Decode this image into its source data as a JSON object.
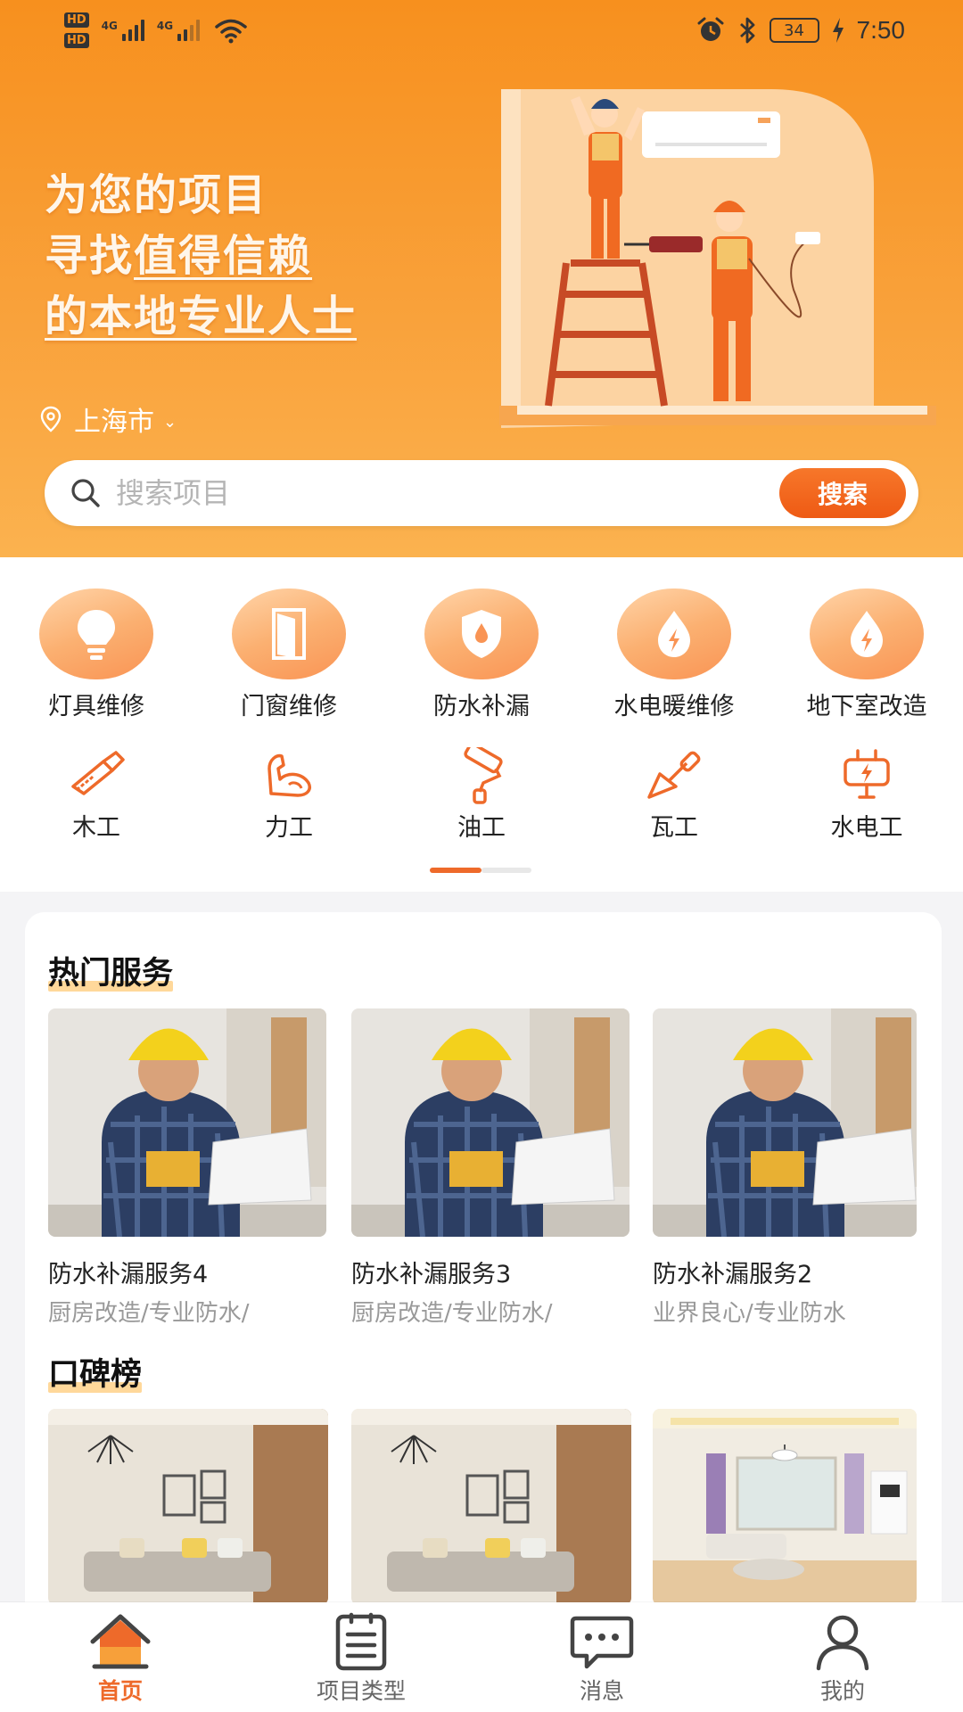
{
  "status_bar": {
    "hd1": "HD",
    "hd2": "HD",
    "net1": "4G",
    "net2": "4G",
    "battery": "34",
    "time": "7:50"
  },
  "hero": {
    "headline_line1": "为您的项目",
    "headline_line2_a": "寻找",
    "headline_line2_b": "值得信赖",
    "headline_line3": "的本地专业人士",
    "city": "上海市",
    "city_chevron": "⌄"
  },
  "search": {
    "placeholder": "搜索项目",
    "button_label": "搜索"
  },
  "categories": [
    {
      "label": "灯具维修",
      "icon": "lightbulb-icon"
    },
    {
      "label": "门窗维修",
      "icon": "door-icon"
    },
    {
      "label": "防水补漏",
      "icon": "shield-drop-icon"
    },
    {
      "label": "水电暖维修",
      "icon": "drop-bolt-icon"
    },
    {
      "label": "地下室改造",
      "icon": "drop-bolt-icon"
    }
  ],
  "trades": [
    {
      "label": "木工",
      "icon": "saw-icon"
    },
    {
      "label": "力工",
      "icon": "muscle-arm-icon"
    },
    {
      "label": "油工",
      "icon": "paint-roller-icon"
    },
    {
      "label": "瓦工",
      "icon": "trowel-icon"
    },
    {
      "label": "水电工",
      "icon": "plug-bolt-icon"
    }
  ],
  "hot_services": {
    "title": "热门服务",
    "items": [
      {
        "name": "防水补漏服务4",
        "tags": "厨房改造/专业防水/"
      },
      {
        "name": "防水补漏服务3",
        "tags": "厨房改造/专业防水/"
      },
      {
        "name": "防水补漏服务2",
        "tags": "业界良心/专业防水"
      }
    ]
  },
  "reputation": {
    "title": "口碑榜"
  },
  "tabbar": [
    {
      "label": "首页",
      "icon": "home-icon",
      "active": true
    },
    {
      "label": "项目类型",
      "icon": "clipboard-list-icon",
      "active": false
    },
    {
      "label": "消息",
      "icon": "chat-bubble-icon",
      "active": false
    },
    {
      "label": "我的",
      "icon": "person-icon",
      "active": false
    }
  ],
  "colors": {
    "brand_orange": "#f7901e",
    "accent": "#ee6a2a",
    "highlight": "#ffd89a"
  }
}
